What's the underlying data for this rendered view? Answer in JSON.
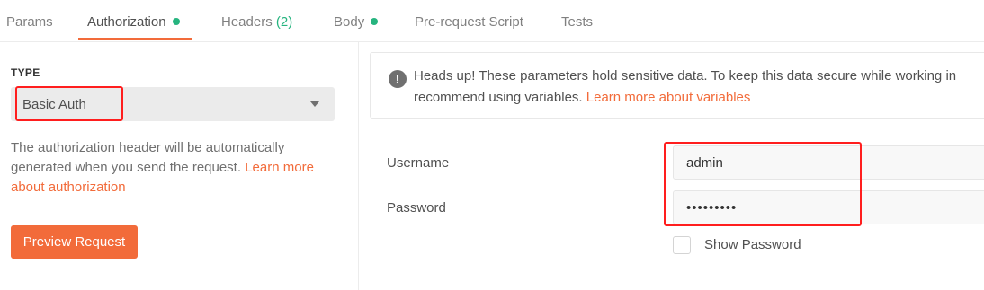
{
  "tabs": {
    "params": "Params",
    "authorization": "Authorization",
    "headers": "Headers",
    "headers_count": "(2)",
    "body": "Body",
    "prerequest": "Pre-request Script",
    "tests": "Tests"
  },
  "auth": {
    "type_label": "TYPE",
    "type_value": "Basic Auth",
    "description": "The authorization header will be automatically generated when you send the request.",
    "learn_more_link": "Learn more about authorization",
    "preview_button": "Preview Request"
  },
  "notice": {
    "icon": "info-icon",
    "text": "Heads up! These parameters hold sensitive data. To keep this data secure while working in",
    "text2": "recommend using variables.",
    "link": "Learn more about variables"
  },
  "fields": {
    "username_label": "Username",
    "username_value": "admin",
    "password_label": "Password",
    "password_value": "•••••••••",
    "show_password_label": "Show Password"
  },
  "colors": {
    "accent": "#f26b3a",
    "status_green": "#26b47f",
    "highlight": "#ff1e1e"
  }
}
